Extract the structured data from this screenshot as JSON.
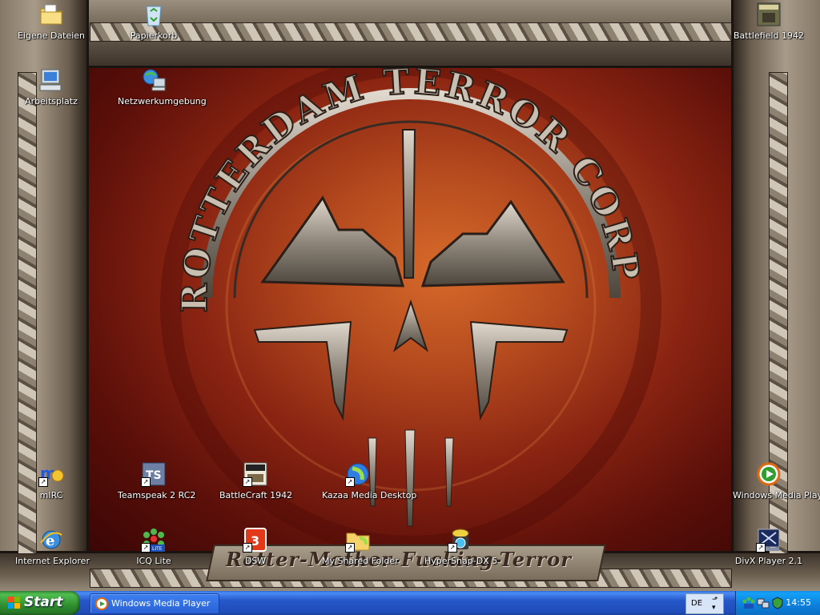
{
  "wallpaper": {
    "logo_top_text": "ROTTERDAM TERROR CORPS",
    "banner_text": "Rotter-Mother-Fucking-Terror"
  },
  "desktop_icons": [
    {
      "id": "eigene-dateien",
      "label": "Eigene Dateien",
      "icon": "folder-documents-icon",
      "shortcut": false
    },
    {
      "id": "papierkorb",
      "label": "Papierkorb",
      "icon": "recycle-bin-icon",
      "shortcut": false
    },
    {
      "id": "battlefield",
      "label": "Battlefield 1942",
      "icon": "battlefield-icon",
      "shortcut": false
    },
    {
      "id": "arbeitsplatz",
      "label": "Arbeitsplatz",
      "icon": "my-computer-icon",
      "shortcut": false
    },
    {
      "id": "netzwerk",
      "label": "Netzwerkumgebung",
      "icon": "network-icon",
      "shortcut": false
    },
    {
      "id": "mirc",
      "label": "mIRC",
      "icon": "mirc-icon",
      "shortcut": true
    },
    {
      "id": "teamspeak",
      "label": "Teamspeak 2 RC2",
      "icon": "teamspeak-icon",
      "shortcut": true
    },
    {
      "id": "battlecraft",
      "label": "BattleCraft 1942",
      "icon": "battlecraft-icon",
      "shortcut": true
    },
    {
      "id": "kazaa",
      "label": "Kazaa Media Desktop",
      "icon": "kazaa-icon",
      "shortcut": true
    },
    {
      "id": "wmp-desktop",
      "label": "Windows Media Player",
      "icon": "media-player-icon",
      "shortcut": false
    },
    {
      "id": "ie",
      "label": "Internet Explorer",
      "icon": "internet-explorer-icon",
      "shortcut": false
    },
    {
      "id": "icq",
      "label": "ICQ Lite",
      "icon": "icq-icon",
      "shortcut": true
    },
    {
      "id": "dsw",
      "label": "DSW",
      "icon": "dsw-icon",
      "shortcut": true
    },
    {
      "id": "shared",
      "label": "My Shared Folder",
      "icon": "shared-folder-icon",
      "shortcut": true
    },
    {
      "id": "hypersnap",
      "label": "HyperSnap-DX 5",
      "icon": "hypersnap-icon",
      "shortcut": true
    },
    {
      "id": "divx",
      "label": "DivX Player 2.1",
      "icon": "divx-icon",
      "shortcut": true
    }
  ],
  "taskbar": {
    "start_label": "Start",
    "task_button_label": "Windows Media Player",
    "language_code": "DE",
    "clock": "14:55"
  },
  "colors": {
    "taskbar_blue": "#2557c9",
    "start_green": "#3c9a3c",
    "tray_blue": "#0c7fdb"
  }
}
